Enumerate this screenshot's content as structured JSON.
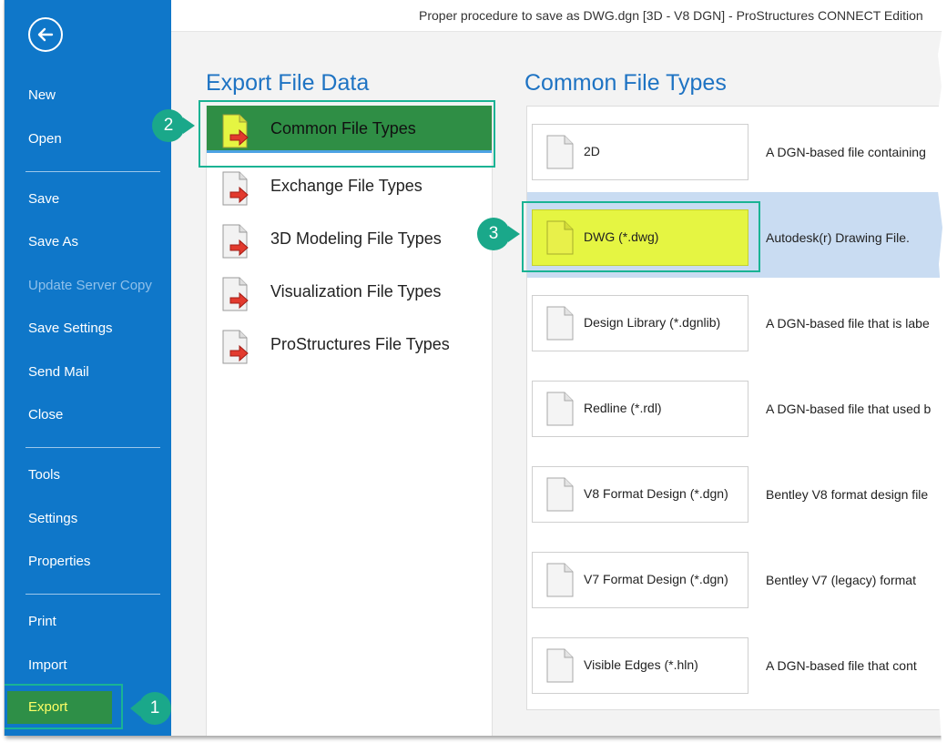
{
  "window": {
    "title": "Proper procedure to save as DWG.dgn [3D - V8 DGN] - ProStructures CONNECT Edition"
  },
  "sidebar": {
    "back_icon": "back-arrow-icon",
    "items": [
      {
        "label": "New"
      },
      {
        "label": "Open"
      },
      {
        "label": "Save"
      },
      {
        "label": "Save As"
      },
      {
        "label": "Update Server Copy",
        "disabled": true
      },
      {
        "label": "Save Settings"
      },
      {
        "label": "Send Mail"
      },
      {
        "label": "Close"
      },
      {
        "label": "Tools"
      },
      {
        "label": "Settings"
      },
      {
        "label": "Properties"
      },
      {
        "label": "Print"
      },
      {
        "label": "Import"
      },
      {
        "label": "Export",
        "selected": true
      }
    ]
  },
  "callouts": {
    "one": "1",
    "two": "2",
    "three": "3"
  },
  "export_panel": {
    "heading": "Export File Data",
    "categories": [
      {
        "label": "Common File Types",
        "selected": true
      },
      {
        "label": "Exchange File Types"
      },
      {
        "label": "3D Modeling File Types"
      },
      {
        "label": "Visualization File Types"
      },
      {
        "label": "ProStructures File Types"
      }
    ]
  },
  "file_types_panel": {
    "heading": "Common File Types",
    "items": [
      {
        "name": "2D",
        "description": "A DGN-based file containing"
      },
      {
        "name": "DWG (*.dwg)",
        "description": "Autodesk(r) Drawing File.",
        "selected": true
      },
      {
        "name": "Design Library (*.dgnlib)",
        "description": "A DGN-based file that is labe"
      },
      {
        "name": "Redline (*.rdl)",
        "description": "A DGN-based file that used b"
      },
      {
        "name": "V8 Format Design (*.dgn)",
        "description": "Bentley V8 format design file"
      },
      {
        "name": "V7 Format Design (*.dgn)",
        "description": "Bentley V7 (legacy) format"
      },
      {
        "name": "Visible Edges (*.hln)",
        "description": "A DGN-based file that cont"
      }
    ]
  },
  "colors": {
    "sidebar": "#0f77c9",
    "accent_green": "#2f8e45",
    "callout": "#1aa88a",
    "highlight_yellow": "#e5f542",
    "selected_row": "#c9dcf2",
    "heading_blue": "#1e73c3"
  }
}
